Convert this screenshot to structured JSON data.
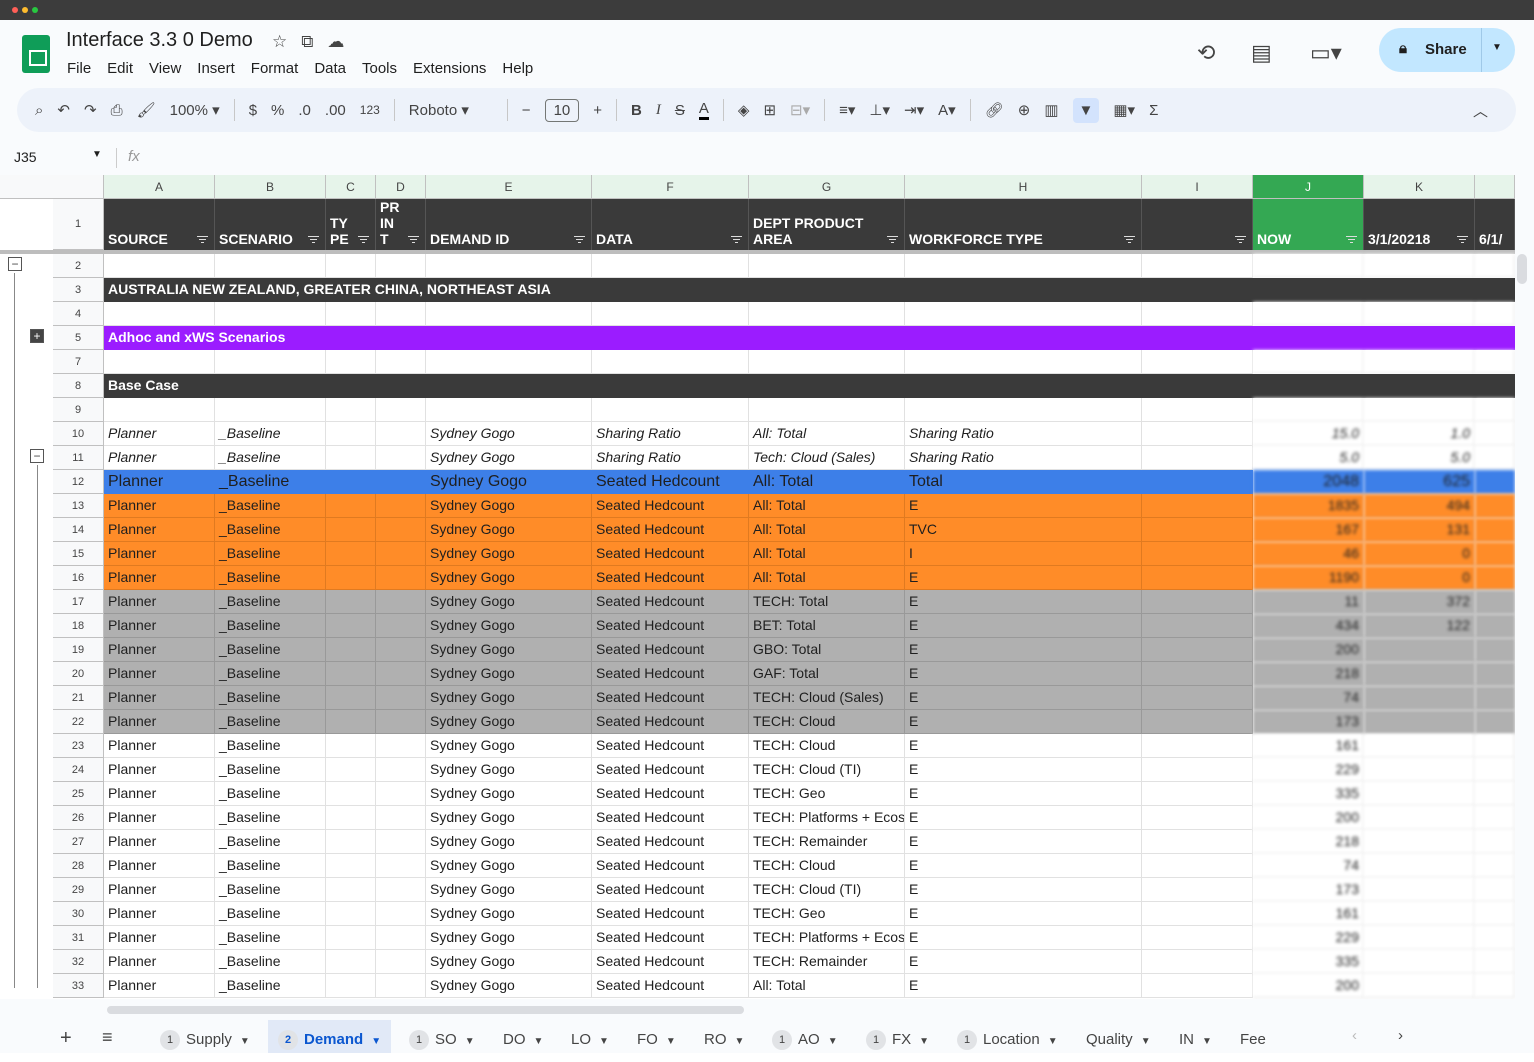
{
  "window": {
    "dots": [
      "#ff5f57",
      "#febc2e",
      "#28c840"
    ]
  },
  "doc": {
    "title": "Interface 3.3 0 Demo",
    "icons": [
      "star-icon",
      "move-to-folder-icon",
      "cloud-saved-icon"
    ]
  },
  "menu": [
    "File",
    "Edit",
    "View",
    "Insert",
    "Format",
    "Data",
    "Tools",
    "Extensions",
    "Help"
  ],
  "share": {
    "label": "Share"
  },
  "toolbar": {
    "zoom": "100%",
    "currency": "$",
    "percent": "%",
    "dec_decrease": ".0",
    "dec_increase": ".00",
    "format_123": "123",
    "font": "Roboto",
    "font_size": "10",
    "bold": "B",
    "italic": "I",
    "strike": "S",
    "textcolor": "A",
    "sum": "Σ"
  },
  "formula_bar": {
    "cell_ref": "J35",
    "fx": "fx",
    "value": ""
  },
  "columns": [
    "A",
    "B",
    "C",
    "D",
    "E",
    "F",
    "G",
    "H",
    "I",
    "J",
    "K",
    ""
  ],
  "header_row": {
    "row": "1",
    "cells": [
      "SOURCE",
      "SCENARIO",
      "TY PE",
      "PR IN T",
      "DEMAND ID",
      "DATA",
      "DEPT PRODUCT AREA",
      "WORKFORCE TYPE",
      "",
      "NOW",
      "3/1/20218",
      "6/1/"
    ]
  },
  "colors": {
    "dark": "#3a3a3a",
    "purple": "#9b1cff",
    "blue": "#3d7fe8",
    "orange": "#ff8c28",
    "gray": "#b0b0b0",
    "selected_col": "#34a853"
  },
  "rows": [
    {
      "n": "2",
      "style": "white",
      "cells": []
    },
    {
      "n": "3",
      "style": "dark",
      "banner": "AUSTRALIA NEW ZEALAND, GREATER CHINA, NORTHEAST ASIA"
    },
    {
      "n": "4",
      "style": "white",
      "cells": []
    },
    {
      "n": "5",
      "style": "purple",
      "banner": "Adhoc and xWS Scenarios"
    },
    {
      "n": "7",
      "style": "white",
      "cells": []
    },
    {
      "n": "8",
      "style": "dark",
      "banner": "Base Case"
    },
    {
      "n": "9",
      "style": "white",
      "cells": []
    },
    {
      "n": "10",
      "style": "italic",
      "cells": [
        "Planner",
        "_Baseline",
        "",
        "",
        "Sydney Gogo",
        "Sharing Ratio",
        "All: Total",
        "Sharing Ratio",
        "",
        "15.0",
        "1.0"
      ]
    },
    {
      "n": "11",
      "style": "italic",
      "cells": [
        "Planner",
        "_Baseline",
        "",
        "",
        "Sydney Gogo",
        "Sharing Ratio",
        "Tech: Cloud (Sales)",
        "Sharing Ratio",
        "",
        "5.0",
        "5.0"
      ]
    },
    {
      "n": "12",
      "style": "blue",
      "cells": [
        "Planner",
        "_Baseline",
        "",
        "",
        "Sydney Gogo",
        "Seated Hedcount",
        "All: Total",
        "Total",
        "",
        "2048",
        "625"
      ]
    },
    {
      "n": "13",
      "style": "orange",
      "cells": [
        "Planner",
        "_Baseline",
        "",
        "",
        "Sydney Gogo",
        "Seated Hedcount",
        "All: Total",
        "E",
        "",
        "1835",
        "494"
      ]
    },
    {
      "n": "14",
      "style": "orange",
      "cells": [
        "Planner",
        "_Baseline",
        "",
        "",
        "Sydney Gogo",
        "Seated Hedcount",
        "All: Total",
        "TVC",
        "",
        "167",
        "131"
      ]
    },
    {
      "n": "15",
      "style": "orange",
      "cells": [
        "Planner",
        "_Baseline",
        "",
        "",
        "Sydney Gogo",
        "Seated Hedcount",
        "All: Total",
        "I",
        "",
        "46",
        "0"
      ]
    },
    {
      "n": "16",
      "style": "orange",
      "cells": [
        "Planner",
        "_Baseline",
        "",
        "",
        "Sydney Gogo",
        "Seated Hedcount",
        "All: Total",
        "E",
        "",
        "1190",
        "0"
      ]
    },
    {
      "n": "17",
      "style": "gray",
      "cells": [
        "Planner",
        "_Baseline",
        "",
        "",
        "Sydney Gogo",
        "Seated Hedcount",
        "TECH: Total",
        "E",
        "",
        "11",
        "372"
      ]
    },
    {
      "n": "18",
      "style": "gray",
      "cells": [
        "Planner",
        "_Baseline",
        "",
        "",
        "Sydney Gogo",
        "Seated Hedcount",
        "BET: Total",
        "E",
        "",
        "434",
        "122"
      ]
    },
    {
      "n": "19",
      "style": "gray",
      "cells": [
        "Planner",
        "_Baseline",
        "",
        "",
        "Sydney Gogo",
        "Seated Hedcount",
        "GBO: Total",
        "E",
        "",
        "200",
        ""
      ]
    },
    {
      "n": "20",
      "style": "gray",
      "cells": [
        "Planner",
        "_Baseline",
        "",
        "",
        "Sydney Gogo",
        "Seated Hedcount",
        "GAF: Total",
        "E",
        "",
        "218",
        ""
      ]
    },
    {
      "n": "21",
      "style": "gray",
      "cells": [
        "Planner",
        "_Baseline",
        "",
        "",
        "Sydney Gogo",
        "Seated Hedcount",
        "TECH: Cloud (Sales)",
        "E",
        "",
        "74",
        ""
      ]
    },
    {
      "n": "22",
      "style": "gray",
      "cells": [
        "Planner",
        "_Baseline",
        "",
        "",
        "Sydney Gogo",
        "Seated Hedcount",
        "TECH: Cloud",
        "E",
        "",
        "173",
        ""
      ]
    },
    {
      "n": "23",
      "style": "plain",
      "cells": [
        "Planner",
        "_Baseline",
        "",
        "",
        "Sydney Gogo",
        "Seated Hedcount",
        "TECH: Cloud",
        "E",
        "",
        "161",
        ""
      ]
    },
    {
      "n": "24",
      "style": "plain",
      "cells": [
        "Planner",
        "_Baseline",
        "",
        "",
        "Sydney Gogo",
        "Seated Hedcount",
        "TECH: Cloud (TI)",
        "E",
        "",
        "229",
        ""
      ]
    },
    {
      "n": "25",
      "style": "plain",
      "cells": [
        "Planner",
        "_Baseline",
        "",
        "",
        "Sydney Gogo",
        "Seated Hedcount",
        "TECH: Geo",
        "E",
        "",
        "335",
        ""
      ]
    },
    {
      "n": "26",
      "style": "plain",
      "cells": [
        "Planner",
        "_Baseline",
        "",
        "",
        "Sydney Gogo",
        "Seated Hedcount",
        "TECH: Platforms + Ecosystems",
        "E",
        "",
        "200",
        ""
      ]
    },
    {
      "n": "27",
      "style": "plain",
      "cells": [
        "Planner",
        "_Baseline",
        "",
        "",
        "Sydney Gogo",
        "Seated Hedcount",
        "TECH: Remainder",
        "E",
        "",
        "218",
        ""
      ]
    },
    {
      "n": "28",
      "style": "plain",
      "cells": [
        "Planner",
        "_Baseline",
        "",
        "",
        "Sydney Gogo",
        "Seated Hedcount",
        "TECH: Cloud",
        "E",
        "",
        "74",
        ""
      ]
    },
    {
      "n": "29",
      "style": "plain",
      "cells": [
        "Planner",
        "_Baseline",
        "",
        "",
        "Sydney Gogo",
        "Seated Hedcount",
        "TECH: Cloud (TI)",
        "E",
        "",
        "173",
        ""
      ]
    },
    {
      "n": "30",
      "style": "plain",
      "cells": [
        "Planner",
        "_Baseline",
        "",
        "",
        "Sydney Gogo",
        "Seated Hedcount",
        "TECH: Geo",
        "E",
        "",
        "161",
        ""
      ]
    },
    {
      "n": "31",
      "style": "plain",
      "cells": [
        "Planner",
        "_Baseline",
        "",
        "",
        "Sydney Gogo",
        "Seated Hedcount",
        "TECH: Platforms + Ecosystems",
        "E",
        "",
        "229",
        ""
      ]
    },
    {
      "n": "32",
      "style": "plain",
      "cells": [
        "Planner",
        "_Baseline",
        "",
        "",
        "Sydney Gogo",
        "Seated Hedcount",
        "TECH: Remainder",
        "E",
        "",
        "335",
        ""
      ]
    },
    {
      "n": "33",
      "style": "plain",
      "cells": [
        "Planner",
        "_Baseline",
        "",
        "",
        "Sydney Gogo",
        "Seated Hedcount",
        "All: Total",
        "E",
        "",
        "200",
        ""
      ]
    }
  ],
  "tabs": [
    {
      "badge": "1",
      "label": "Supply"
    },
    {
      "badge": "2",
      "label": "Demand",
      "active": true
    },
    {
      "badge": "1",
      "label": "SO"
    },
    {
      "badge": "",
      "label": "DO"
    },
    {
      "badge": "",
      "label": "LO"
    },
    {
      "badge": "",
      "label": "FO"
    },
    {
      "badge": "",
      "label": "RO"
    },
    {
      "badge": "1",
      "label": "AO"
    },
    {
      "badge": "1",
      "label": "FX"
    },
    {
      "badge": "1",
      "label": "Location"
    },
    {
      "badge": "",
      "label": "Quality"
    },
    {
      "badge": "",
      "label": "IN"
    },
    {
      "badge": "",
      "label": "Fee"
    }
  ]
}
